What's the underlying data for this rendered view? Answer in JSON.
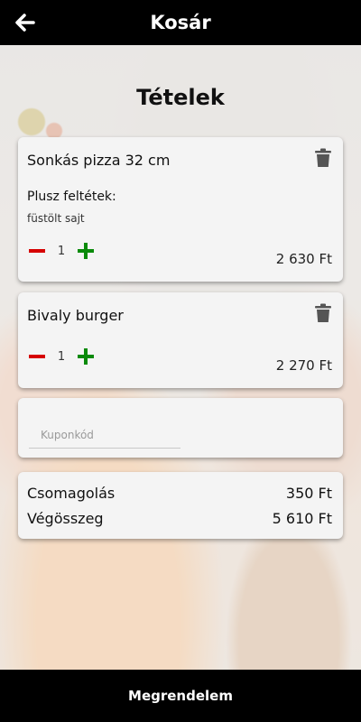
{
  "header": {
    "title": "Kosár",
    "back_icon": "arrow-left-icon"
  },
  "section_title": "Tételek",
  "items": [
    {
      "name": "Sonkás pizza 32 cm",
      "extras_label": "Plusz feltétek:",
      "extras_value": "füstölt sajt",
      "quantity": "1",
      "price": "2 630 Ft"
    },
    {
      "name": "Bivaly burger",
      "quantity": "1",
      "price": "2 270 Ft"
    }
  ],
  "coupon": {
    "placeholder": "Kuponkód",
    "value": ""
  },
  "summary": {
    "packaging_label": "Csomagolás",
    "packaging_value": "350 Ft",
    "total_label": "Végösszeg",
    "total_value": "5 610 Ft"
  },
  "footer": {
    "order_button": "Megrendelem"
  },
  "colors": {
    "minus": "#d60000",
    "plus": "#0a8a0a",
    "bar": "#000000"
  }
}
